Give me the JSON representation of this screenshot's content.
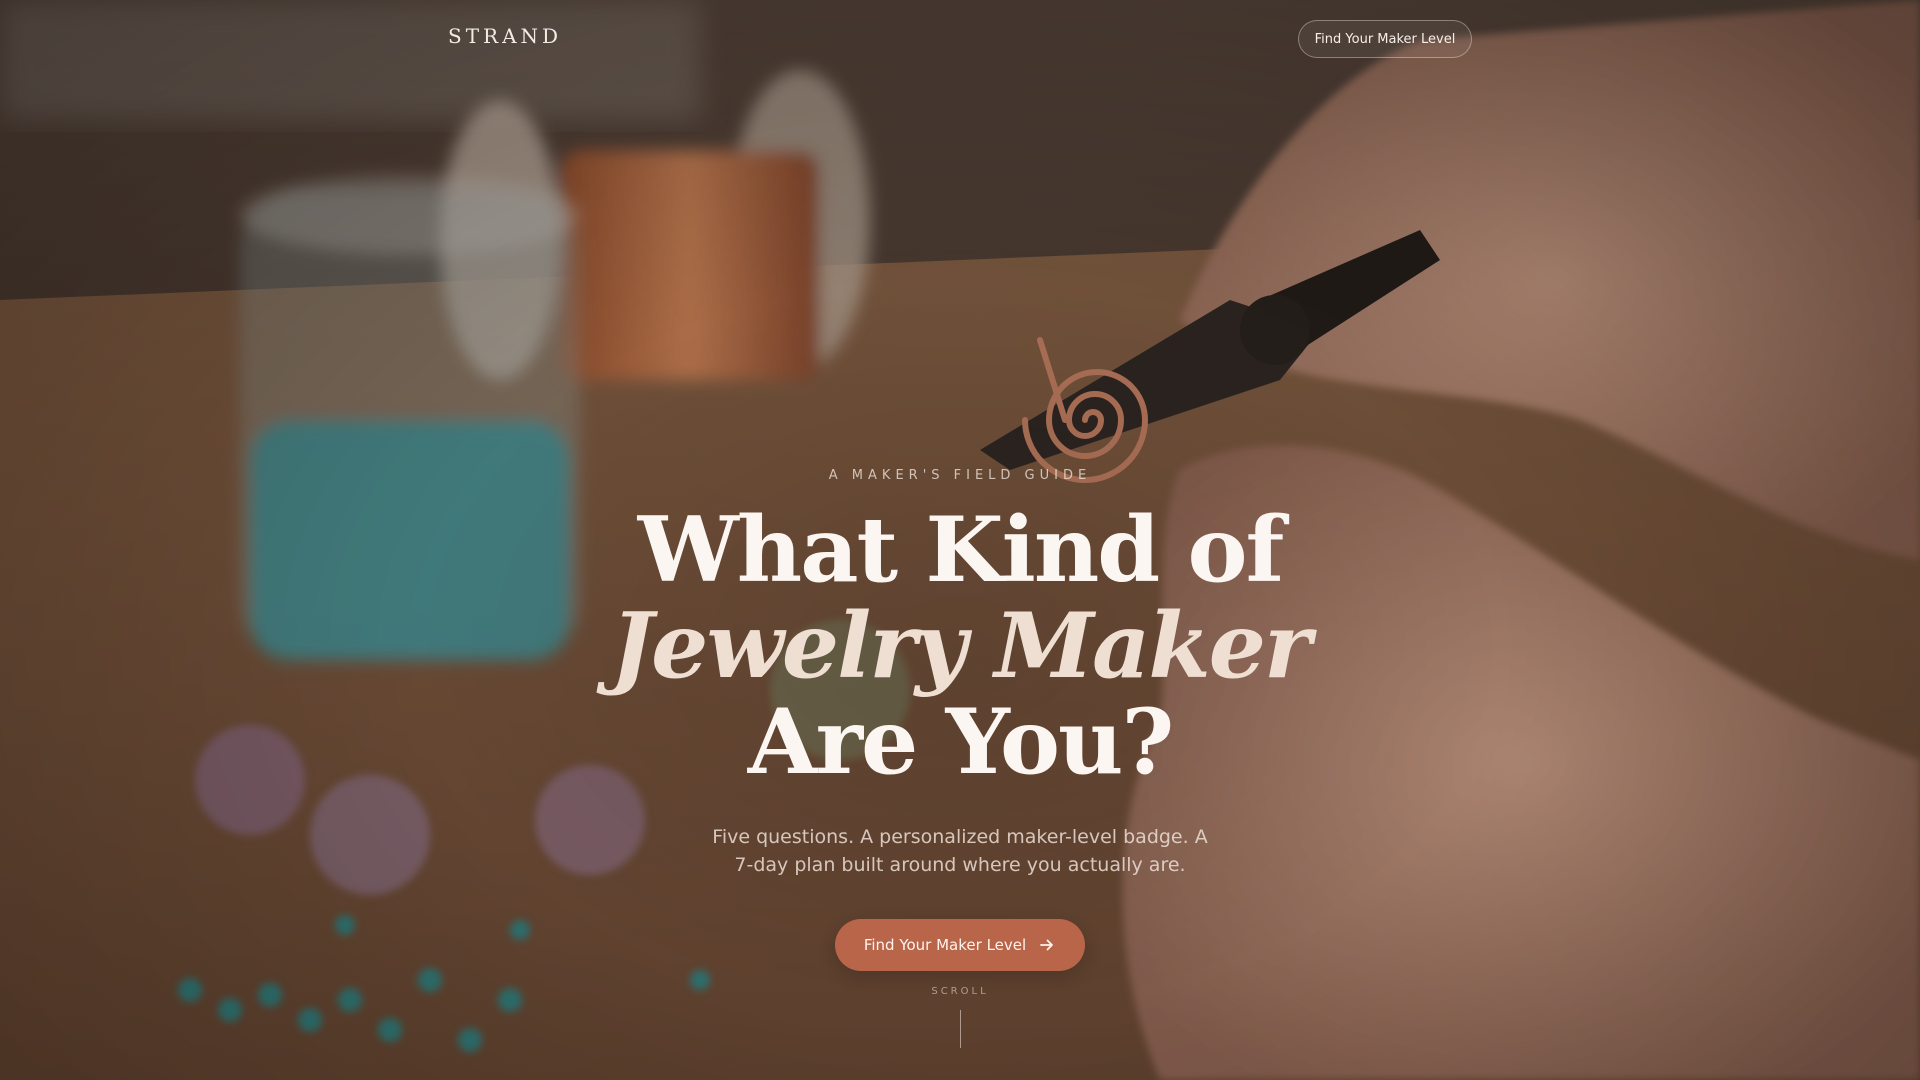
{
  "nav": {
    "brand": "STRAND",
    "cta_label": "Find Your Maker Level"
  },
  "hero": {
    "eyebrow": "A MAKER'S FIELD GUIDE",
    "headline_line1": "What Kind of",
    "headline_line2": "Jewelry Maker",
    "headline_line3": "Are You?",
    "subtext": "Five questions. A personalized maker-level badge. A 7-day plan built around where you actually are.",
    "cta_label": "Find Your Maker Level",
    "cta_icon": "arrow-right-icon",
    "scroll_label": "SCROLL"
  },
  "colors": {
    "accent": "#b9654a",
    "text": "#fbf6f1"
  }
}
